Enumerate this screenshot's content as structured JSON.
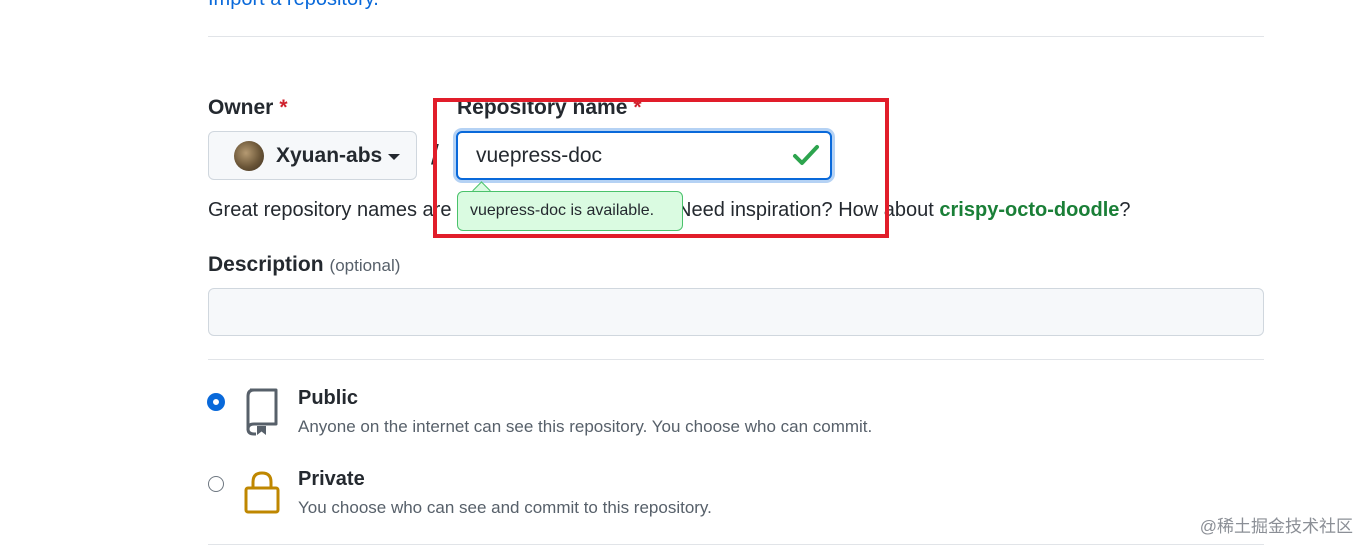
{
  "import_link": "Import a repository.",
  "owner": {
    "label": "Owner",
    "required_mark": "*",
    "name": "Xyuan-abs"
  },
  "separator": "/",
  "repo": {
    "label": "Repository name",
    "required_mark": "*",
    "value": "vuepress-doc",
    "availability": "vuepress-doc is available."
  },
  "hint": {
    "prefix": "Great repository names are",
    "middle": "Need inspiration? How about",
    "suggestion": "crispy-octo-doodle",
    "suffix": "?"
  },
  "description": {
    "label": "Description",
    "optional": "(optional)",
    "value": ""
  },
  "visibility": [
    {
      "title": "Public",
      "desc": "Anyone on the internet can see this repository. You choose who can commit.",
      "selected": true,
      "icon": "repo-icon"
    },
    {
      "title": "Private",
      "desc": "You choose who can see and commit to this repository.",
      "selected": false,
      "icon": "lock-icon"
    }
  ],
  "watermark": "@稀土掘金技术社区",
  "colors": {
    "accent": "#0969da",
    "success": "#1a7f37",
    "highlight_box": "#e11d2a",
    "lock": "#bf8700"
  }
}
